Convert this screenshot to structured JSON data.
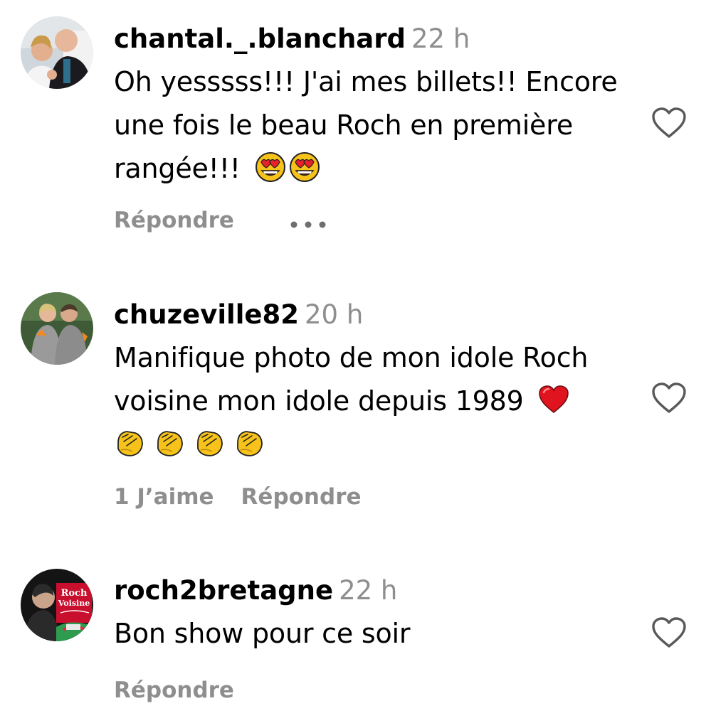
{
  "comments": [
    {
      "username": "chantal._.blanchard",
      "time": "22 h",
      "text_lines": [
        "Oh yesssss!!! J'ai mes billets!! Encore",
        "une fois le beau Roch en première",
        "rangée!!!"
      ],
      "emojis": [
        "heart-eyes-emoji",
        "heart-eyes-emoji"
      ],
      "reply_label": "Répondre",
      "more_icon": "more-options-icon",
      "like_icon": "heart-outline-icon"
    },
    {
      "username": "chuzeville82",
      "time": "20 h",
      "text_lines": [
        "Manifique photo de mon idole Roch",
        "voisine mon idole depuis 1989"
      ],
      "emojis": [
        "red-heart-emoji",
        "clapping-hands-emoji",
        "clapping-hands-emoji",
        "clapping-hands-emoji",
        "clapping-hands-emoji"
      ],
      "likes_label": "1 J’aime",
      "reply_label": "Répondre",
      "like_icon": "heart-outline-icon"
    },
    {
      "username": "roch2bretagne",
      "time": "22 h",
      "text_lines": [
        "Bon show pour ce soir"
      ],
      "reply_label": "Répondre",
      "like_icon": "heart-outline-icon",
      "avatar_text": [
        "Roch",
        "Voisine"
      ]
    }
  ],
  "colors": {
    "text": "#000000",
    "secondary": "#8e8e8e",
    "heart_red": "#e0141e",
    "emoji_yellow": "#f7c21a"
  }
}
